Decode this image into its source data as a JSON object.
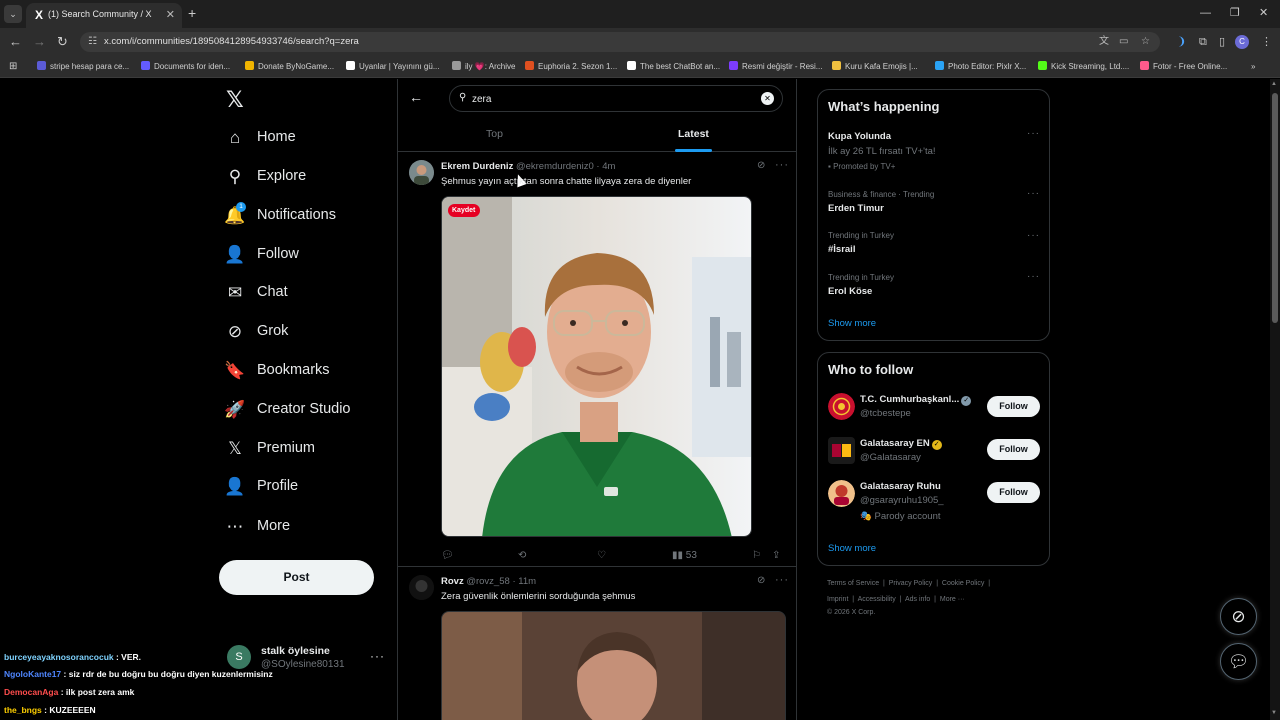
{
  "browser": {
    "tab_title": "(1) Search Community / X",
    "tab_favicon": "X",
    "url": "x.com/i/communities/1895084128954933746/search?q=zera",
    "bookmarks": [
      {
        "label": "stripe hesap para ce...",
        "color": "#5b5bd6"
      },
      {
        "label": "Documents for iden...",
        "color": "#635bff"
      },
      {
        "label": "Donate ByNoGame...",
        "color": "#f0b400"
      },
      {
        "label": "Uyanlar | Yayınını gü...",
        "color": "#ffffff"
      },
      {
        "label": "ily 💗: Archive",
        "color": "#999999"
      },
      {
        "label": "Euphoria 2. Sezon 1...",
        "color": "#e05020"
      },
      {
        "label": "The best ChatBot an...",
        "color": "#ffffff"
      },
      {
        "label": "Resmi değiştir - Resi...",
        "color": "#7d3cff"
      },
      {
        "label": "Kuru Kafa Emojis |...",
        "color": "#f0c040"
      },
      {
        "label": "Photo Editor: Pixlr X...",
        "color": "#2aa3f5"
      },
      {
        "label": "Kick Streaming, Ltd....",
        "color": "#53fc18"
      },
      {
        "label": "Fotor - Free Online...",
        "color": "#ff5a8c"
      }
    ],
    "profile_initial": "C"
  },
  "nav": {
    "items": [
      {
        "label": "Home",
        "icon": "home-icon",
        "glyph": "⌂"
      },
      {
        "label": "Explore",
        "icon": "search-icon",
        "glyph": "⚲"
      },
      {
        "label": "Notifications",
        "icon": "bell-icon",
        "glyph": "🔔",
        "badge": "1"
      },
      {
        "label": "Follow",
        "icon": "person-add-icon",
        "glyph": "👤"
      },
      {
        "label": "Chat",
        "icon": "mail-icon",
        "glyph": "✉"
      },
      {
        "label": "Grok",
        "icon": "grok-icon",
        "glyph": "⊘"
      },
      {
        "label": "Bookmarks",
        "icon": "bookmark-icon",
        "glyph": "🔖"
      },
      {
        "label": "Creator Studio",
        "icon": "rocket-icon",
        "glyph": "🚀"
      },
      {
        "label": "Premium",
        "icon": "x-icon",
        "glyph": "𝕏"
      },
      {
        "label": "Profile",
        "icon": "profile-icon",
        "glyph": "👤"
      },
      {
        "label": "More",
        "icon": "more-circle-icon",
        "glyph": "⋯"
      }
    ],
    "post_label": "Post",
    "account": {
      "name": "stalk öylesine",
      "handle": "@SOylesine80131",
      "initial": "S"
    }
  },
  "chat_overlay": [
    {
      "user": "burceyeayaknosorancocuk",
      "color": "#7fd3ff",
      "message": ": VER."
    },
    {
      "user": "NgoloKante17",
      "color": "#4f86ff",
      "message": ": siz rdr de bu doğru bu doğru diyen kuzenlermisinz"
    },
    {
      "user": "DemocanAga",
      "color": "#ff4d4d",
      "message": ": ilk post zera amk"
    },
    {
      "user": "the_bngs",
      "color": "#ffd000",
      "message": ": KUZEEEEN"
    }
  ],
  "search": {
    "query": "zera",
    "tabs": [
      {
        "label": "Top",
        "active": false
      },
      {
        "label": "Latest",
        "active": true
      }
    ]
  },
  "tweets": [
    {
      "name": "Ekrem Durdeniz",
      "handle": "@ekremdurdeniz0",
      "time": "4m",
      "text": "Şehmus yayın açtıktan sonra chatte lilyaya zera de diyenler",
      "media_badge": "Kaydet",
      "views": "53"
    },
    {
      "name": "Rovz",
      "handle": "@rovz_58",
      "time": "11m",
      "text": "Zera güvenlik önlemlerini sorduğunda şehmus"
    }
  ],
  "whats_happening": {
    "title": "What’s happening",
    "trends": [
      {
        "name": "Kupa Yolunda",
        "sub": "İlk ay 26 TL fırsatı TV+'ta!",
        "promo": "Promoted by TV+"
      },
      {
        "context": "Business & finance · Trending",
        "name": "Erden Timur"
      },
      {
        "context": "Trending in Turkey",
        "name": "#İsrail"
      },
      {
        "context": "Trending in Turkey",
        "name": "Erol Köse"
      }
    ],
    "show_more": "Show more"
  },
  "who_to_follow": {
    "title": "Who to follow",
    "accounts": [
      {
        "name": "T.C. Cumhurbaşkanl...",
        "handle": "@tcbestepe",
        "verified_color": "#829aab"
      },
      {
        "name": "Galatasaray EN",
        "handle": "@Galatasaray",
        "verified_color": "#e2b719"
      },
      {
        "name": "Galatasaray Ruhu",
        "handle": "@gsarayruhu1905_",
        "sub": "Parody account"
      }
    ],
    "follow_label": "Follow",
    "show_more": "Show more"
  },
  "footer": {
    "line1": [
      "Terms of Service",
      "Privacy Policy",
      "Cookie Policy"
    ],
    "line2": [
      "Imprint",
      "Accessibility",
      "Ads info",
      "More ···"
    ],
    "copyright": "© 2026 X Corp."
  }
}
